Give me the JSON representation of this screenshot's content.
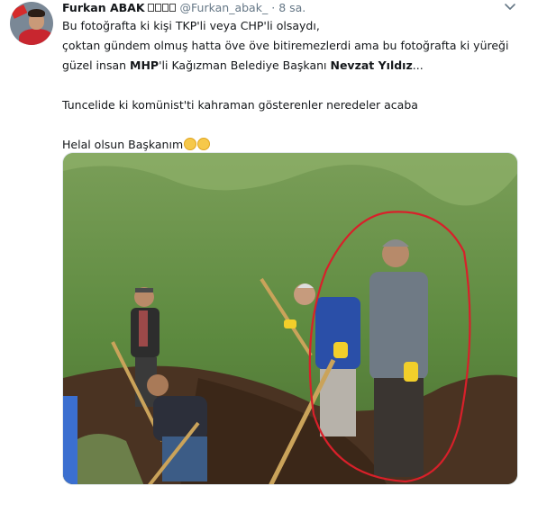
{
  "tweet": {
    "author_name": "Furkan ABAK",
    "author_symbols": "□□□□",
    "handle": "@Furkan_abak_",
    "separator": "·",
    "time": "8 sa.",
    "lines": [
      "Bu fotoğrafta ki kişi TKP'li veya CHP'li olsaydı,",
      "çoktan gündem olmuş hatta öve öve bitiremezlerdi ama bu fotoğrafta ki yüreği"
    ],
    "line3": {
      "a": "güzel insan ",
      "b": "MHP",
      "c": "'li Kağızman Belediye Başkanı ",
      "d": "Nevzat Yıldız",
      "e": "..."
    },
    "line4": "Tuncelide ki komünist'ti kahraman gösterenler neredeler acaba",
    "line5": "Helal olsun Başkanım",
    "icons": {
      "menu": "chevron-down-icon",
      "emoji": "clapping-hands-icon",
      "avatar": "profile-avatar"
    }
  },
  "colors": {
    "text": "#14171a",
    "secondary": "#657786",
    "highlight_circle": "#d8202a"
  }
}
